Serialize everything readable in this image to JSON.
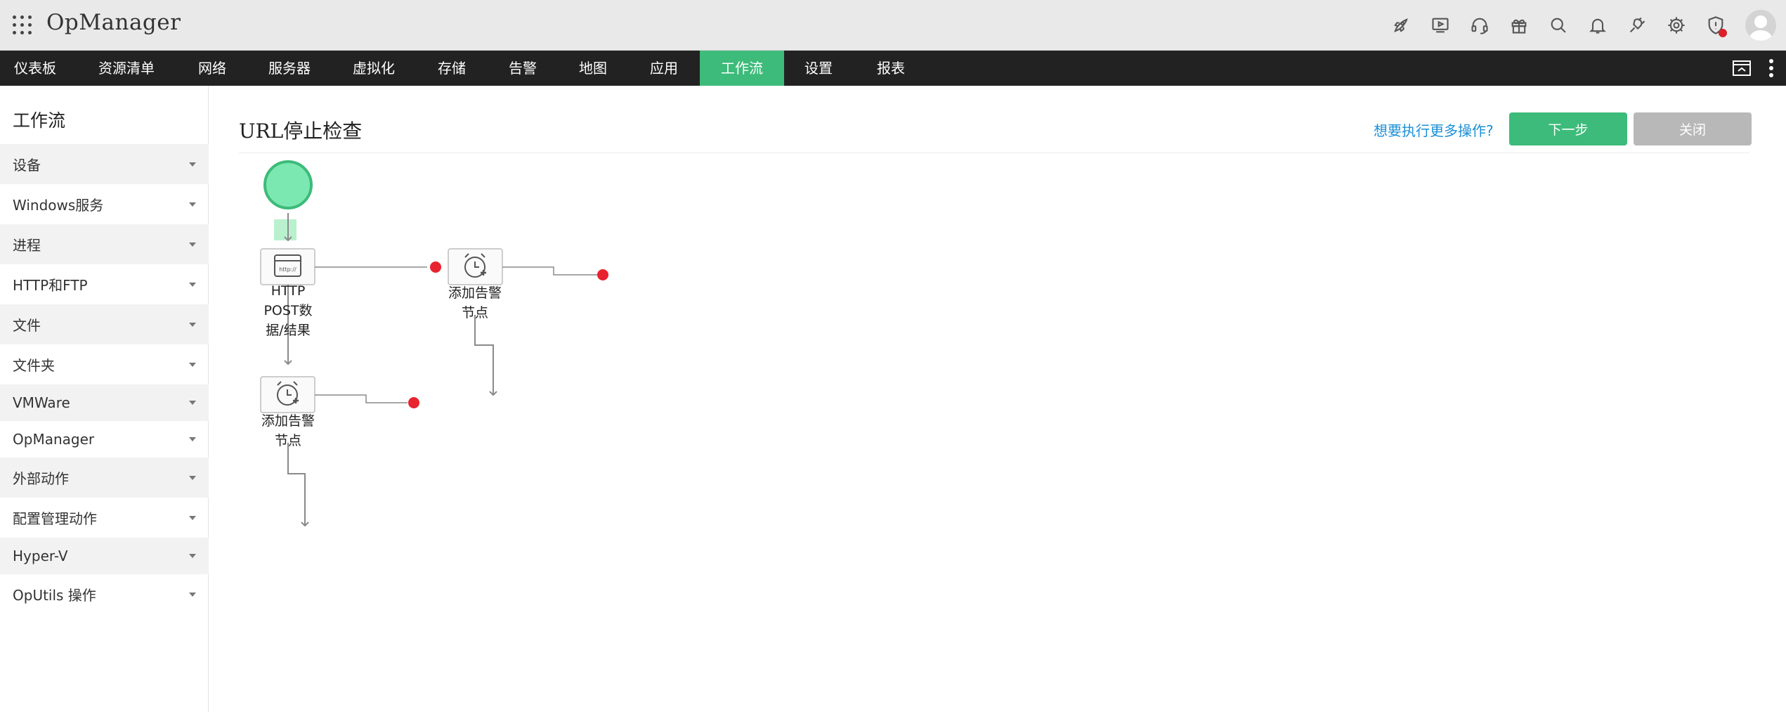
{
  "app": {
    "name": "OpManager"
  },
  "header": {
    "icons": [
      "rocket-icon",
      "video-icon",
      "headset-icon",
      "gift-icon",
      "search-icon",
      "bell-icon",
      "plug-icon",
      "gear-icon",
      "security-alert-icon",
      "avatar"
    ]
  },
  "nav": {
    "items": [
      {
        "label": "仪表板"
      },
      {
        "label": "资源清单"
      },
      {
        "label": "网络"
      },
      {
        "label": "服务器"
      },
      {
        "label": "虚拟化"
      },
      {
        "label": "存储"
      },
      {
        "label": "告警"
      },
      {
        "label": "地图"
      },
      {
        "label": "应用"
      },
      {
        "label": "工作流"
      },
      {
        "label": "设置"
      },
      {
        "label": "报表"
      }
    ],
    "active": "工作流"
  },
  "sidebar": {
    "title": "工作流",
    "items": [
      {
        "label": "设备"
      },
      {
        "label": "Windows服务"
      },
      {
        "label": "进程"
      },
      {
        "label": "HTTP和FTP"
      },
      {
        "label": "文件"
      },
      {
        "label": "文件夹"
      },
      {
        "label": "VMWare"
      },
      {
        "label": "OpManager"
      },
      {
        "label": "外部动作"
      },
      {
        "label": "配置管理动作"
      },
      {
        "label": "Hyper-V"
      },
      {
        "label": "OpUtils 操作"
      }
    ]
  },
  "main": {
    "title": "URL停止检查",
    "more_actions_link": "想要执行更多操作?",
    "next_button": "下一步",
    "close_button": "关闭"
  },
  "workflow": {
    "nodes": [
      {
        "label_line1": "HTTP",
        "label_line2": "POST数",
        "label_line3": "据/结果",
        "icon": "http-icon"
      },
      {
        "label_line1": "添加告警",
        "label_line2": "节点",
        "icon": "alarm-plus-icon"
      },
      {
        "label_line1": "添加告警",
        "label_line2": "节点",
        "icon": "alarm-plus-icon"
      }
    ]
  },
  "colors": {
    "accent_green": "#3dbb7a",
    "nav_bg": "#222222",
    "header_bg": "#e9e9e9",
    "link_blue": "#1a8fd6",
    "end_dot_red": "#e8232f",
    "start_circle": "#7ce8b1",
    "close_gray": "#b8b8b8"
  }
}
